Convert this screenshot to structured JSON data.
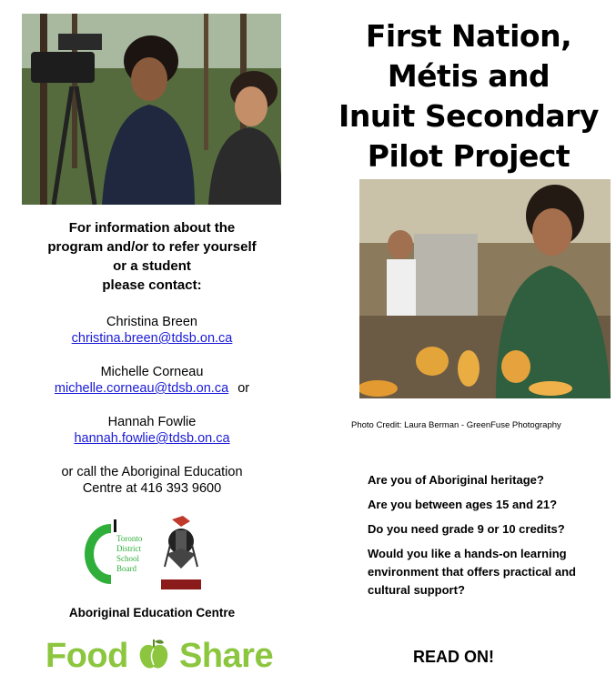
{
  "title_lines": [
    "First Nation,",
    "Métis and",
    "Inuit Secondary",
    "Pilot Project"
  ],
  "contact": {
    "heading_lines": [
      "For information about the",
      "program and/or to refer yourself",
      "or a student",
      "please contact:"
    ],
    "people": [
      {
        "name": "Christina Breen",
        "email": "christina.breen@tdsb.on.ca",
        "suffix": ""
      },
      {
        "name": "Michelle Corneau",
        "email": "michelle.corneau@tdsb.on.ca",
        "suffix": "or"
      },
      {
        "name": "Hannah Fowlie",
        "email": "hannah.fowlie@tdsb.on.ca",
        "suffix": ""
      }
    ],
    "call_lines": [
      "or call the Aboriginal Education",
      "Centre at 416 393 9600"
    ]
  },
  "logos": {
    "tdsb_lines": [
      "Toronto",
      "District",
      "School",
      "Board"
    ],
    "aec_label": "Aboriginal Education Centre",
    "foodshare": {
      "left": "Food",
      "right": "Share",
      "color": "#8cc63f"
    }
  },
  "photo_credit": "Photo Credit: Laura Berman - GreenFuse Photography",
  "questions": [
    "Are you of Aboriginal heritage?",
    "Are you between ages 15 and 21?",
    "Do you need grade 9 or 10 credits?",
    "Would you like a hands-on learning environment that offers practical and cultural support?"
  ],
  "read_on": "READ ON!",
  "colors": {
    "link": "#1a1ad8",
    "foodshare_green": "#8cc63f",
    "tdsb_green": "#2fae3a"
  }
}
